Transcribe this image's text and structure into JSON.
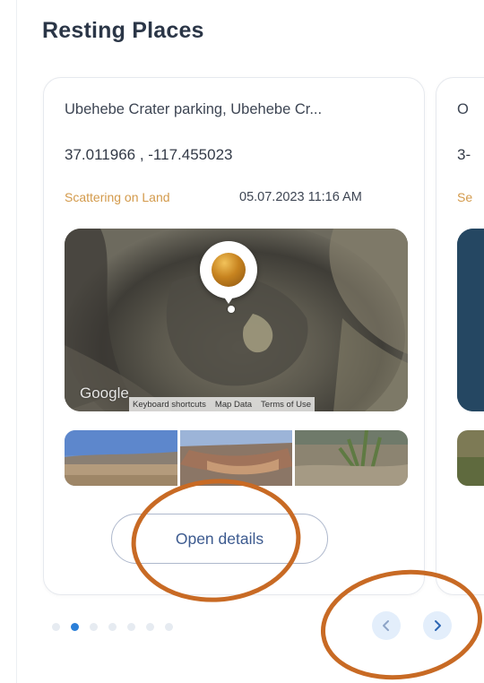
{
  "section": {
    "title": "Resting Places"
  },
  "cards": [
    {
      "place": "Ubehebe Crater parking, Ubehebe Cr...",
      "coords": "37.011966 , -117.455023",
      "type": "Scattering on Land",
      "datetime": "05.07.2023 11:16 AM",
      "map": {
        "brand": "Google",
        "attrib_shortcuts": "Keyboard shortcuts",
        "attrib_data": "Map Data",
        "attrib_terms": "Terms of Use"
      },
      "photo_count": 3,
      "action_label": "Open details"
    },
    {
      "place": "O",
      "coords": "3-",
      "type": "Se"
    }
  ],
  "pagination": {
    "total": 7,
    "active_index": 1
  },
  "icons": {
    "prev": "chevron-left-icon",
    "next": "chevron-right-icon",
    "pin": "map-pin-icon"
  },
  "colors": {
    "title": "#2b3647",
    "accent_blue": "#2b7fd8",
    "type_label": "#d39a4b",
    "button_text": "#3c5a8f",
    "annotation": "#c86a24"
  }
}
